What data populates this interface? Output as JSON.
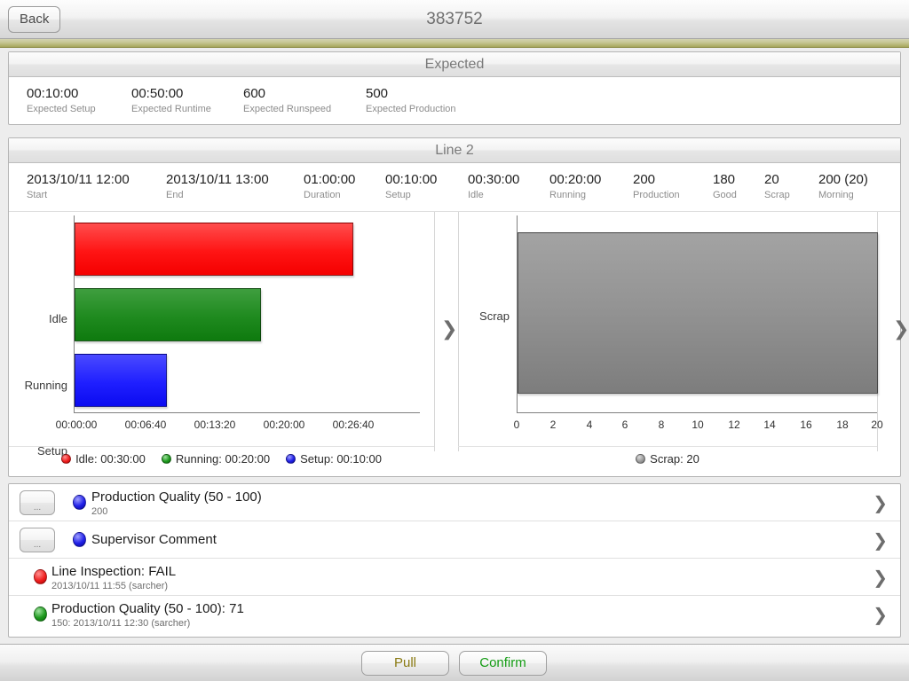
{
  "navbar": {
    "back_label": "Back",
    "title": "383752"
  },
  "expected_panel": {
    "header": "Expected",
    "stats": [
      {
        "value": "00:10:00",
        "label": "Expected Setup",
        "x": 20
      },
      {
        "value": "00:50:00",
        "label": "Expected Runtime",
        "x": 138
      },
      {
        "value": "600",
        "label": "Expected Runspeed",
        "x": 264
      },
      {
        "value": "500",
        "label": "Expected Production",
        "x": 402
      }
    ]
  },
  "line_panel": {
    "header": "Line 2",
    "stats": [
      {
        "value": "2013/10/11 12:00",
        "label": "Start",
        "x": 20
      },
      {
        "value": "2013/10/11 13:00",
        "label": "End",
        "x": 177
      },
      {
        "value": "01:00:00",
        "label": "Duration",
        "x": 332
      },
      {
        "value": "00:10:00",
        "label": "Setup",
        "x": 424
      },
      {
        "value": "00:30:00",
        "label": "Idle",
        "x": 517
      },
      {
        "value": "00:20:00",
        "label": "Running",
        "x": 609
      },
      {
        "value": "200",
        "label": "Production",
        "x": 703
      },
      {
        "value": "180",
        "label": "Good",
        "x": 793
      },
      {
        "value": "20",
        "label": "Scrap",
        "x": 851
      },
      {
        "value": "200 (20)",
        "label": "Morning",
        "x": 912
      }
    ],
    "next_chevron_icon": "❯"
  },
  "chart_data": [
    {
      "type": "bar",
      "orientation": "horizontal",
      "title": "",
      "categories": [
        "Idle",
        "Running",
        "Setup"
      ],
      "values": [
        1800,
        1200,
        600
      ],
      "value_display": [
        "00:30:00",
        "00:20:00",
        "00:10:00"
      ],
      "colors": [
        "#ff0000",
        "#188a18",
        "#1414ff"
      ],
      "xlabel": "",
      "ylabel": "",
      "xlim": [
        0,
        1990
      ],
      "ticks": [
        "00:00:00",
        "00:06:40",
        "00:13:20",
        "00:20:00",
        "00:26:40"
      ],
      "tick_values": [
        0,
        400,
        800,
        1200,
        1600
      ],
      "grid": false,
      "legend_position": "bottom",
      "legend": [
        {
          "label": "Idle: 00:30:00",
          "color": "red"
        },
        {
          "label": "Running: 00:20:00",
          "color": "green"
        },
        {
          "label": "Setup: 00:10:00",
          "color": "blue"
        }
      ]
    },
    {
      "type": "bar",
      "orientation": "horizontal",
      "title": "",
      "categories": [
        "Scrap"
      ],
      "values": [
        20
      ],
      "value_display": [
        "20"
      ],
      "colors": [
        "#8c8c8c"
      ],
      "xlabel": "",
      "ylabel": "",
      "xlim": [
        0,
        20
      ],
      "ticks": [
        "0",
        "2",
        "4",
        "6",
        "8",
        "10",
        "12",
        "14",
        "16",
        "18",
        "20"
      ],
      "tick_values": [
        0,
        2,
        4,
        6,
        8,
        10,
        12,
        14,
        16,
        18,
        20
      ],
      "grid": false,
      "legend_position": "bottom",
      "legend": [
        {
          "label": "Scrap: 20",
          "color": "gray"
        }
      ]
    }
  ],
  "list": {
    "chevron_icon": "❯",
    "dots_label": "...",
    "rows": [
      {
        "has_button": true,
        "dot": "blue",
        "title": "Production Quality (50 - 100)",
        "subtitle": "200"
      },
      {
        "has_button": true,
        "dot": "blue",
        "title": "Supervisor Comment",
        "subtitle": ""
      },
      {
        "has_button": false,
        "dot": "red",
        "title": "Line Inspection: FAIL",
        "subtitle": "2013/10/11 11:55 (sarcher)"
      },
      {
        "has_button": false,
        "dot": "green",
        "title": "Production Quality (50 - 100): 71",
        "subtitle": "150: 2013/10/11 12:30 (sarcher)"
      }
    ]
  },
  "footer": {
    "pull_label": "Pull",
    "confirm_label": "Confirm",
    "pull_color": "#8a7a12",
    "confirm_color": "#139c13"
  }
}
